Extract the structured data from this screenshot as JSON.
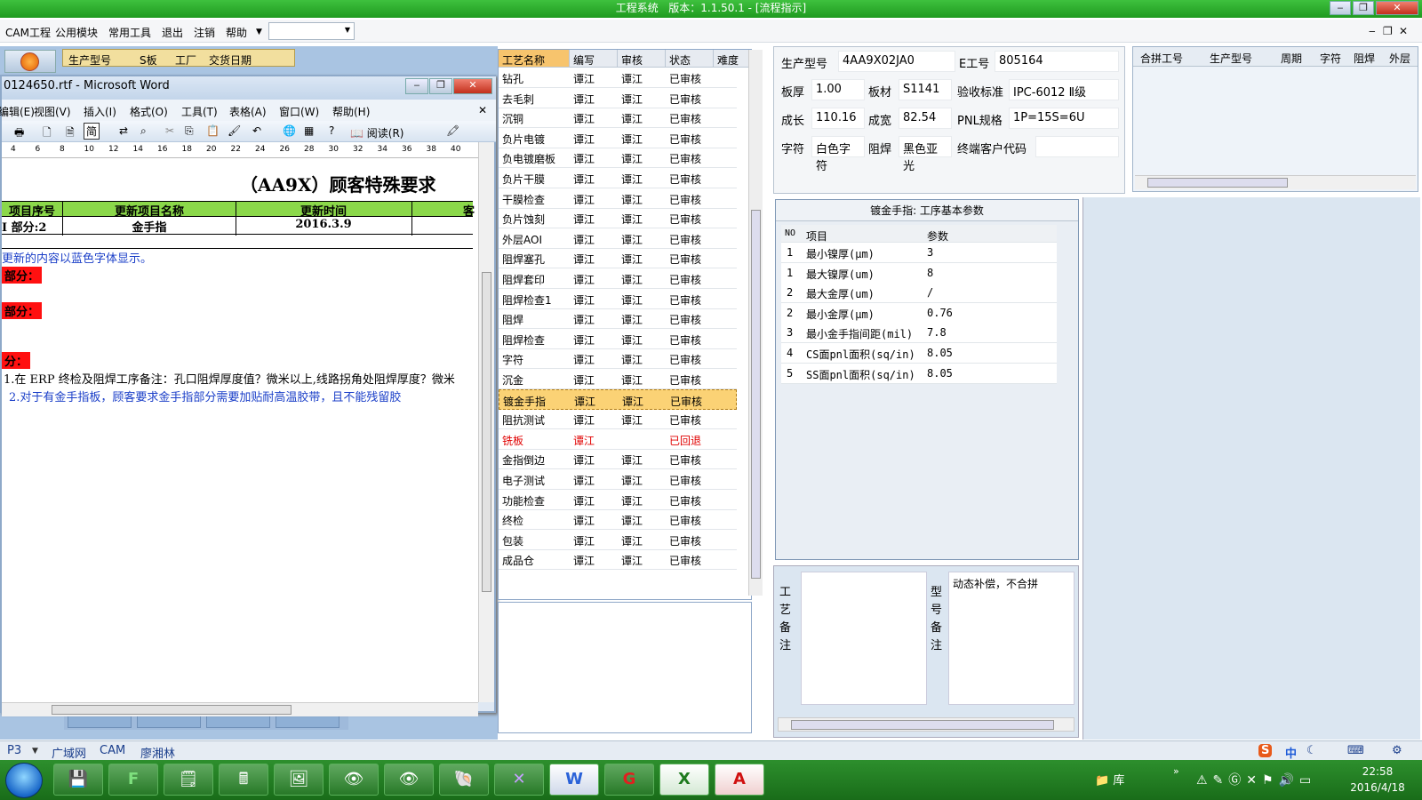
{
  "app": {
    "title": "工程系统",
    "version": "版本：1.1.50.1 - [流程指示]"
  },
  "menu": [
    "CAM工程",
    "公用模块",
    "常用工具",
    "退出",
    "注销",
    "帮助"
  ],
  "left_grid_headers": [
    "生产型号",
    "S板",
    "工厂",
    "交货日期"
  ],
  "word": {
    "title": "0124650.rtf - Microsoft Word",
    "menu": [
      "编辑(E)",
      "视图(V)",
      "插入(I)",
      "格式(O)",
      "工具(T)",
      "表格(A)",
      "窗口(W)",
      "帮助(H)"
    ],
    "read_label": "阅读(R)",
    "ruler": [
      "4",
      "6",
      "8",
      "10",
      "12",
      "14",
      "16",
      "18",
      "20",
      "22",
      "24",
      "26",
      "28",
      "30",
      "32",
      "34",
      "36",
      "38",
      "40"
    ],
    "doc_title": "（AA9X）顾客特殊要求",
    "table_headers": [
      "项目序号",
      "更新项目名称",
      "更新时间",
      "客"
    ],
    "table_row": [
      "I 部分:2",
      "金手指",
      "2016.3.9",
      ""
    ],
    "note": "更新的内容以蓝色字体显示。",
    "part1": "部分：",
    "part2": "部分：",
    "part3": "分：",
    "line1": "1.在 ERP 终检及阻焊工序备注：孔口阻焊厚度值？微米以上,线路拐角处阻焊厚度？微米",
    "line2": "2.对于有金手指板，顾客要求金手指部分需要加贴耐高温胶带，且不能残留胶"
  },
  "process_table": {
    "headers": [
      "工艺名称",
      "编写",
      "审核",
      "状态",
      "难度"
    ],
    "rows": [
      [
        "钻孔",
        "谭江",
        "谭江",
        "已审核"
      ],
      [
        "去毛刺",
        "谭江",
        "谭江",
        "已审核"
      ],
      [
        "沉铜",
        "谭江",
        "谭江",
        "已审核"
      ],
      [
        "负片电镀",
        "谭江",
        "谭江",
        "已审核"
      ],
      [
        "负电镀磨板",
        "谭江",
        "谭江",
        "已审核"
      ],
      [
        "负片干膜",
        "谭江",
        "谭江",
        "已审核"
      ],
      [
        "干膜检查",
        "谭江",
        "谭江",
        "已审核"
      ],
      [
        "负片蚀刻",
        "谭江",
        "谭江",
        "已审核"
      ],
      [
        "外层AOI",
        "谭江",
        "谭江",
        "已审核"
      ],
      [
        "阻焊塞孔",
        "谭江",
        "谭江",
        "已审核"
      ],
      [
        "阻焊套印",
        "谭江",
        "谭江",
        "已审核"
      ],
      [
        "阻焊检查1",
        "谭江",
        "谭江",
        "已审核"
      ],
      [
        "阻焊",
        "谭江",
        "谭江",
        "已审核"
      ],
      [
        "阻焊检查",
        "谭江",
        "谭江",
        "已审核"
      ],
      [
        "字符",
        "谭江",
        "谭江",
        "已审核"
      ],
      [
        "沉金",
        "谭江",
        "谭江",
        "已审核"
      ],
      [
        "镀金手指",
        "谭江",
        "谭江",
        "已审核"
      ],
      [
        "阻抗测试",
        "谭江",
        "谭江",
        "已审核"
      ],
      [
        "铣板",
        "谭江",
        "",
        "已回退"
      ],
      [
        "金指倒边",
        "谭江",
        "谭江",
        "已审核"
      ],
      [
        "电子测试",
        "谭江",
        "谭江",
        "已审核"
      ],
      [
        "功能检查",
        "谭江",
        "谭江",
        "已审核"
      ],
      [
        "终检",
        "谭江",
        "谭江",
        "已审核"
      ],
      [
        "包装",
        "谭江",
        "谭江",
        "已审核"
      ],
      [
        "成品仓",
        "谭江",
        "谭江",
        "已审核"
      ]
    ],
    "selected_index": 16,
    "rejected_index": 18
  },
  "info": {
    "model_label": "生产型号",
    "model": "4AA9X02JA0",
    "e_label": "E工号",
    "e": "805164",
    "thick_label": "板厚",
    "thick": "1.00",
    "mat_label": "板材",
    "mat": "S1141",
    "std_label": "验收标准",
    "std": "IPC-6012 Ⅱ级",
    "len_label": "成长",
    "len": "110.16",
    "wid_label": "成宽",
    "wid": "82.54",
    "pnl_label": "PNL规格",
    "pnl": "1P=15S=6U",
    "char_label": "字符",
    "char": "白色字符",
    "mask_label": "阻焊",
    "mask": "黑色亚光",
    "cust_label": "终端客户代码",
    "cust": ""
  },
  "merge_headers": [
    "合拼工号",
    "生产型号",
    "周期",
    "字符",
    "阻焊",
    "外层"
  ],
  "params": {
    "title": "镀金手指: 工序基本参数",
    "headers": [
      "NO",
      "项目",
      "参数"
    ],
    "rows": [
      [
        "1",
        "最小镍厚(μm)",
        "3"
      ],
      [
        "1",
        "最大镍厚(um)",
        "8"
      ],
      [
        "2",
        "最大金厚(um)",
        "/"
      ],
      [
        "2",
        "最小金厚(μm)",
        "0.76"
      ],
      [
        "3",
        "最小金手指间距(mil)",
        "7.8"
      ],
      [
        "4",
        "CS面pnl面积(sq/in)",
        "8.05"
      ],
      [
        "5",
        "SS面pnl面积(sq/in)",
        "8.05"
      ]
    ]
  },
  "remarks": {
    "process_label": "工艺备注",
    "model_label": "型号备注",
    "model_text": "动态补偿，不合拼"
  },
  "status": {
    "page": "P3",
    "net": "广域网",
    "dept": "CAM",
    "user": "廖湘林"
  },
  "clock": {
    "time": "22:58",
    "date": "2016/4/18"
  },
  "tray": {
    "lib": "库"
  },
  "ime": "中"
}
